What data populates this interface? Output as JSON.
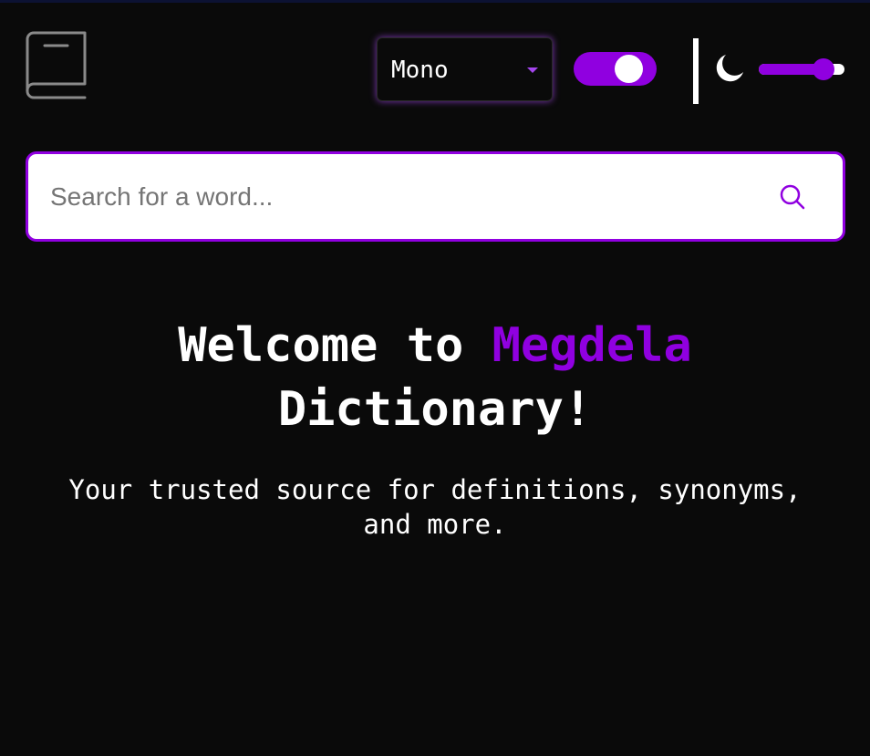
{
  "header": {
    "logo_icon": "book-icon",
    "font_select": {
      "value": "Mono",
      "icon": "chevron-down-icon"
    },
    "theme_toggle": {
      "state": "on"
    },
    "theme_icon": "moon-icon",
    "theme_slider": {
      "value_fraction": 0.76
    }
  },
  "search": {
    "placeholder": "Search for a word...",
    "value": "",
    "icon": "search-icon"
  },
  "hero": {
    "title_prefix": "Welcome to ",
    "title_brand": "Megdela",
    "title_suffix": "Dictionary!",
    "tagline": "Your trusted source for definitions, synonyms, and more."
  },
  "colors": {
    "background": "#0a0a0a",
    "accent": "#9000e0",
    "text": "#ffffff",
    "search_background": "#ffffff"
  }
}
